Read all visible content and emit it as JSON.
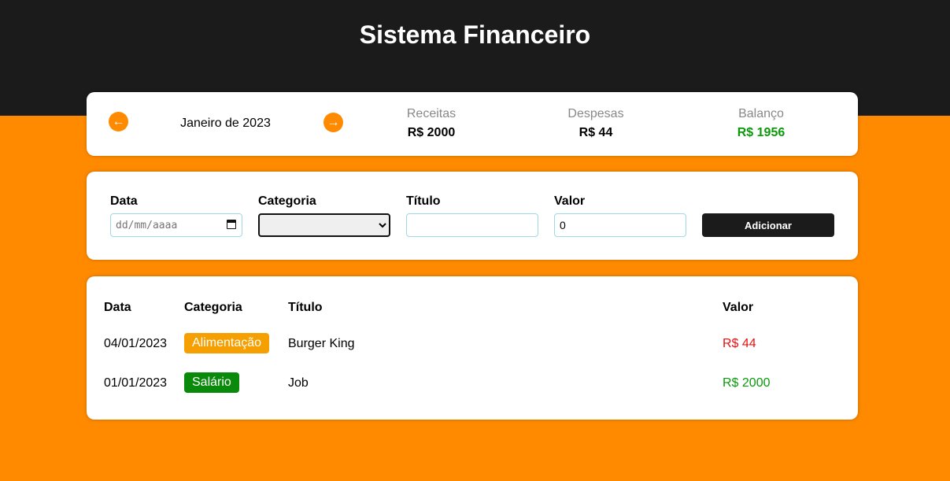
{
  "header": {
    "title": "Sistema Financeiro"
  },
  "info": {
    "prev_icon": "arrow-left-icon",
    "next_icon": "arrow-right-icon",
    "month": "Janeiro de 2023",
    "income": {
      "title": "Receitas",
      "value": "R$ 2000"
    },
    "expense": {
      "title": "Despesas",
      "value": "R$ 44"
    },
    "balance": {
      "title": "Balanço",
      "value": "R$ 1956",
      "color": "#0a9a0a"
    }
  },
  "form": {
    "date": {
      "label": "Data",
      "placeholder": "dd/mm/aaaa"
    },
    "category": {
      "label": "Categoria",
      "value": ""
    },
    "title": {
      "label": "Título",
      "value": ""
    },
    "value": {
      "label": "Valor",
      "value": "0"
    },
    "add_button": "Adicionar"
  },
  "table": {
    "headers": {
      "date": "Data",
      "category": "Categoria",
      "title": "Título",
      "value": "Valor"
    },
    "rows": [
      {
        "date": "04/01/2023",
        "category": "Alimentação",
        "category_color": "#f5a000",
        "title": "Burger King",
        "value": "R$ 44",
        "value_color": "#e81010"
      },
      {
        "date": "01/01/2023",
        "category": "Salário",
        "category_color": "#0a8a0a",
        "title": "Job",
        "value": "R$ 2000",
        "value_color": "#0a9a0a"
      }
    ]
  }
}
